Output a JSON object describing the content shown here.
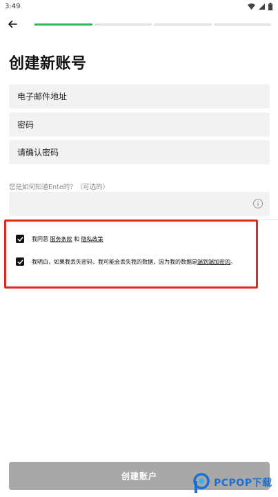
{
  "status_bar": {
    "time": "3:49"
  },
  "progress": {
    "total_steps": 4,
    "current_step": 1,
    "active_color": "#2bb85a"
  },
  "page": {
    "title": "创建新账号"
  },
  "form": {
    "email_placeholder": "电子邮件地址",
    "password_placeholder": "密码",
    "confirm_placeholder": "请确认密码",
    "hint_label": "您是如何知道Ente的？（可选的）",
    "hint_value": ""
  },
  "agreements": {
    "terms_prefix": "我同意",
    "terms_link": "服务条款",
    "terms_and": "和",
    "privacy_link": "隐私政策",
    "warning_text": "我明白，如果我丢失密码，我可能会丢失我的数据，因为我的数据是",
    "encryption_link": "端到端加密的",
    "warning_suffix": "。"
  },
  "actions": {
    "create_label": "创建账户"
  },
  "watermark": {
    "brand": "PCPOP下载"
  },
  "colors": {
    "highlight": "#e5281e",
    "button_disabled": "#a8a8a8",
    "field_bg": "#f2f2f2"
  },
  "icons": [
    "wifi-icon",
    "signal-icon",
    "battery-icon",
    "back-arrow-icon",
    "info-icon",
    "checkbox-checked-icon"
  ]
}
